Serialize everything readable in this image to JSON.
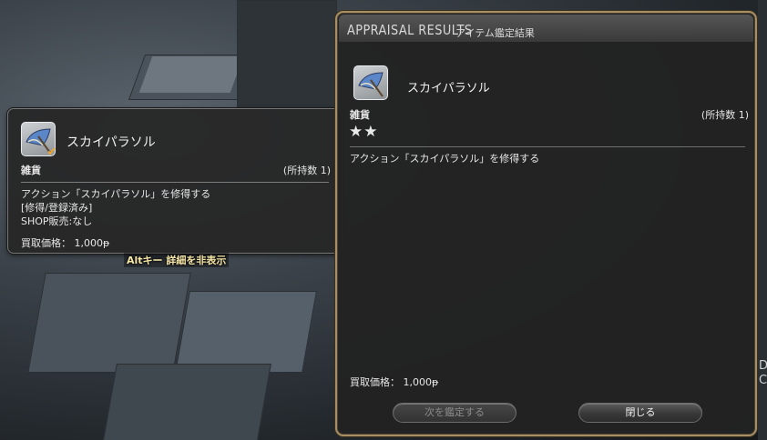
{
  "tooltip": {
    "item_name": "スカイパラソル",
    "category": "雑貨",
    "owned": "(所持数 1)",
    "desc_lines": [
      "アクション「スカイパラソル」を修得する",
      "[修得/登録済み]",
      "SHOP販売:なし"
    ],
    "price": "買取価格： 1,000ᵽ",
    "alt_hint": "Altキー 詳細を非表示"
  },
  "window": {
    "title": "APPRAISAL RESULTS",
    "title_sub": "アイテム鑑定結果",
    "item_name": "スカイパラソル",
    "category": "雑貨",
    "owned": "(所持数 1)",
    "stars": "★★",
    "description": "アクション「スカイパラソル」を修得する",
    "price": "買取価格： 1,000ᵽ",
    "buttons": {
      "next": "次を鑑定する",
      "close": "閉じる"
    }
  },
  "edge_text": [
    "D",
    "C"
  ],
  "icons": {
    "item": "parasol-icon",
    "owned_check": "check-icon",
    "rarity": "star-icon"
  },
  "colors": {
    "window_border": "#a88f63",
    "check": "#f0a426",
    "hint_text": "#f6e6a8"
  }
}
